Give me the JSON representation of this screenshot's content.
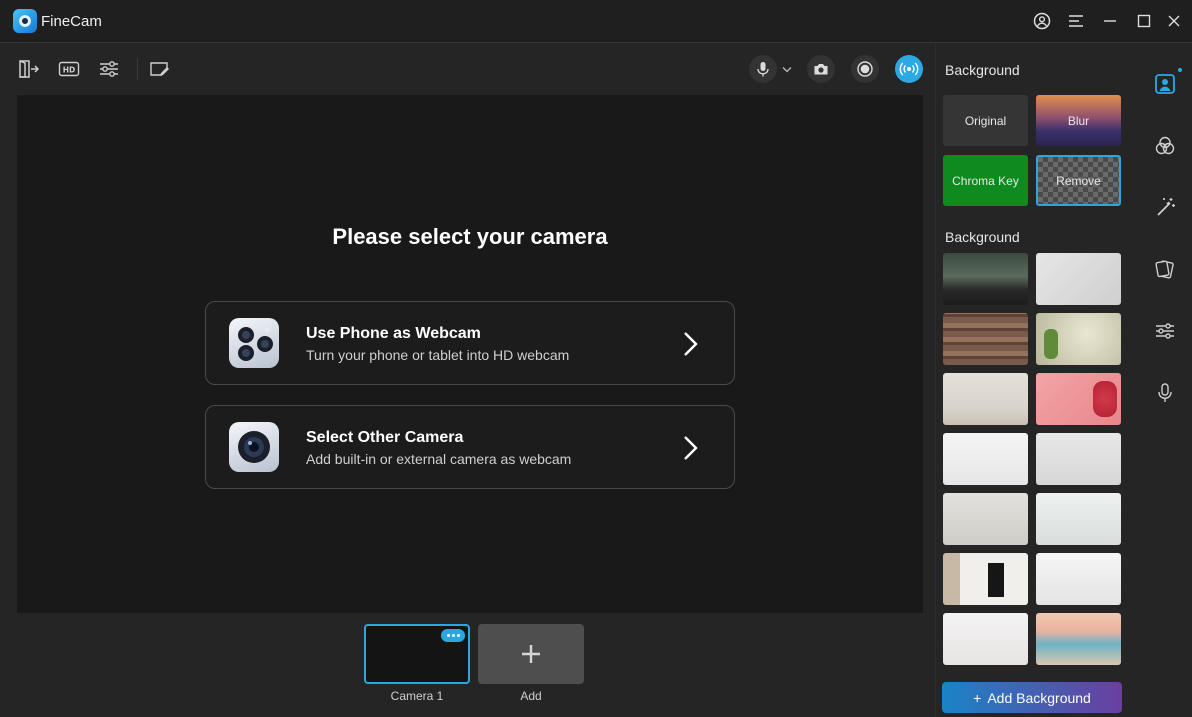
{
  "app": {
    "title": "FineCam"
  },
  "preview": {
    "title": "Please select your camera",
    "options": [
      {
        "title": "Use Phone as Webcam",
        "subtitle": "Turn your phone or tablet into HD webcam"
      },
      {
        "title": "Select Other Camera",
        "subtitle": "Add built-in or external camera as webcam"
      }
    ]
  },
  "cameras": {
    "items": [
      {
        "label": "Camera 1"
      }
    ],
    "add_label": "Add"
  },
  "panel": {
    "mode_title": "Background",
    "modes": [
      {
        "label": "Original"
      },
      {
        "label": "Blur"
      },
      {
        "label": "Chroma Key"
      },
      {
        "label": "Remove",
        "selected": true
      }
    ],
    "backgrounds_title": "Background",
    "add_button": "Add Background",
    "add_icon": "+"
  },
  "colors": {
    "accent": "#29a8e0",
    "chroma": "#0f8a1f"
  },
  "icons": {
    "toolbar": [
      "exit-icon",
      "hd-icon",
      "adjust-sliders-icon",
      "whiteboard-icon"
    ],
    "media": [
      "microphone-icon",
      "chevron-down-icon",
      "camera-snapshot-icon",
      "record-icon",
      "broadcast-icon"
    ],
    "rail": [
      "portrait-icon",
      "filters-icon",
      "magic-wand-icon",
      "stickers-icon",
      "adjust-icon",
      "microphone-icon"
    ],
    "window": [
      "account-icon",
      "menu-icon",
      "minimize-icon",
      "maximize-icon",
      "close-icon"
    ]
  }
}
